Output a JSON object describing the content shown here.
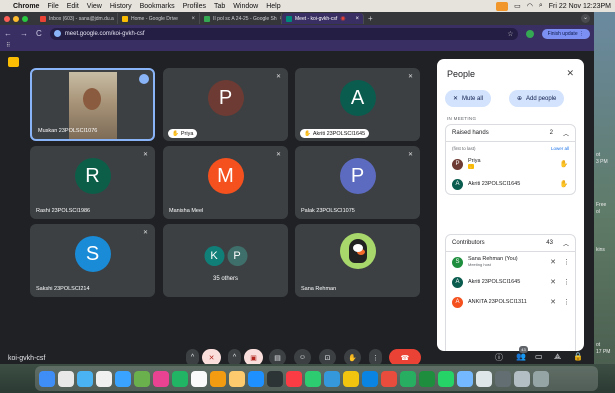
{
  "menubar": {
    "app": "Chrome",
    "items": [
      "File",
      "Edit",
      "View",
      "History",
      "Bookmarks",
      "Profiles",
      "Tab",
      "Window",
      "Help"
    ],
    "clock": "Fri 22 Nov 12:23PM"
  },
  "browser": {
    "tabs": [
      {
        "label": "Inbox (603) - sana@jdm.du.a",
        "color": "#ea4335"
      },
      {
        "label": "Home - Google Drive",
        "color": "#fbbc04"
      },
      {
        "label": "II pol sc A 24-25 - Google Sh",
        "color": "#34a853"
      },
      {
        "label": "Meet - koi-gvkh-csf",
        "color": "#00897b"
      }
    ],
    "url": "meet.google.com/koi-gvkh-csf",
    "finish_update": "Finish update"
  },
  "desktop_strip": [
    "ot",
    "3 PM",
    "Free",
    "ol",
    "kins",
    "ot",
    "17 PM"
  ],
  "tiles": [
    {
      "name": "Muskan 23POLSCI1076",
      "type": "video"
    },
    {
      "name": "Priya",
      "initial": "P",
      "color": "#6d3b33",
      "hand": true
    },
    {
      "name": "Akriti 23POLSCI1645",
      "initial": "A",
      "color": "#0a5c4f",
      "hand": true
    },
    {
      "name": "Rashi 23POLSCI1986",
      "initial": "R",
      "color": "#0d5e49"
    },
    {
      "name": "Manisha Meel",
      "initial": "M",
      "color": "#f4511e"
    },
    {
      "name": "Palak 23POLSCI1075",
      "initial": "P",
      "color": "#5c6bc0"
    },
    {
      "name": "Sakshi 23POLSCI214",
      "initial": "S",
      "color": "#1a8bd6"
    },
    {
      "name": "35 others",
      "initials": [
        "K",
        "P"
      ],
      "type": "others"
    },
    {
      "name": "Sana Rehman",
      "type": "puffin"
    }
  ],
  "people_panel": {
    "title": "People",
    "mute_all": "Mute all",
    "add_people": "Add people",
    "section_label": "IN MEETING",
    "raised_hands": {
      "title": "Raised hands",
      "count": "2",
      "order_label": "(first to last)",
      "lower_all": "Lower all",
      "people": [
        {
          "name": "Priya",
          "initial": "P",
          "color": "#6d3b33"
        },
        {
          "name": "Akriti 23POLSCI1645",
          "initial": "A",
          "color": "#0a5c4f"
        }
      ]
    },
    "contributors": {
      "title": "Contributors",
      "count": "43",
      "people": [
        {
          "name": "Sana Rehman (You)",
          "sub": "Meeting host",
          "initial": "S",
          "color": "#1e8e3e"
        },
        {
          "name": "Akriti 23POLSCI1645",
          "initial": "A",
          "color": "#0a5c4f"
        },
        {
          "name": "ANKITA 23POLSCI1311",
          "initial": "A",
          "color": "#f4511e"
        }
      ]
    }
  },
  "bottom": {
    "meeting_code": "koi-gvkh-csf",
    "participant_badge": "43"
  }
}
